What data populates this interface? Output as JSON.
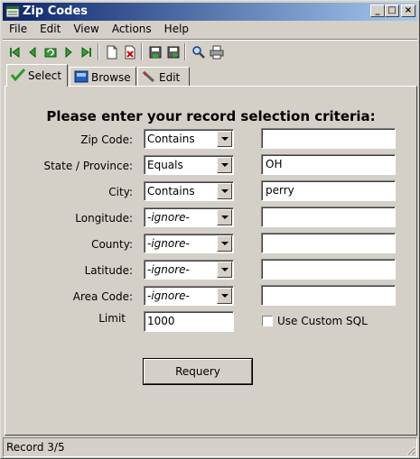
{
  "window": {
    "title": "Zip Codes"
  },
  "caption_buttons": {
    "minimize": "_",
    "maximize": "□",
    "close": "×"
  },
  "menu": [
    "File",
    "Edit",
    "View",
    "Actions",
    "Help"
  ],
  "toolbar": {
    "buttons": [
      "first-record",
      "previous-record",
      "refresh",
      "next-record",
      "last-record",
      "new-record",
      "delete-record",
      "save",
      "save-as",
      "find",
      "print"
    ]
  },
  "tabs": [
    {
      "label": "Select",
      "icon": "checkmark-icon",
      "active": true
    },
    {
      "label": "Browse",
      "icon": "browse-icon",
      "active": false
    },
    {
      "label": "Edit",
      "icon": "edit-icon",
      "active": false
    }
  ],
  "form": {
    "heading": "Please enter your record selection criteria:",
    "rows": [
      {
        "label": "Zip Code:",
        "operator": "Contains",
        "value": "",
        "ignore": false
      },
      {
        "label": "State / Province:",
        "operator": "Equals",
        "value": "OH",
        "ignore": false
      },
      {
        "label": "City:",
        "operator": "Contains",
        "value": "perry",
        "ignore": false
      },
      {
        "label": "Longitude:",
        "operator": "-ignore-",
        "value": "",
        "ignore": true
      },
      {
        "label": "County:",
        "operator": "-ignore-",
        "value": "",
        "ignore": true
      },
      {
        "label": "Latitude:",
        "operator": "-ignore-",
        "value": "",
        "ignore": true
      },
      {
        "label": "Area Code:",
        "operator": "-ignore-",
        "value": "",
        "ignore": true
      }
    ],
    "limit_label": "Limit",
    "limit_value": "1000",
    "custom_sql_label": "Use Custom SQL",
    "custom_sql_checked": false,
    "requery_label": "Requery"
  },
  "status": {
    "text": "Record 3/5"
  }
}
